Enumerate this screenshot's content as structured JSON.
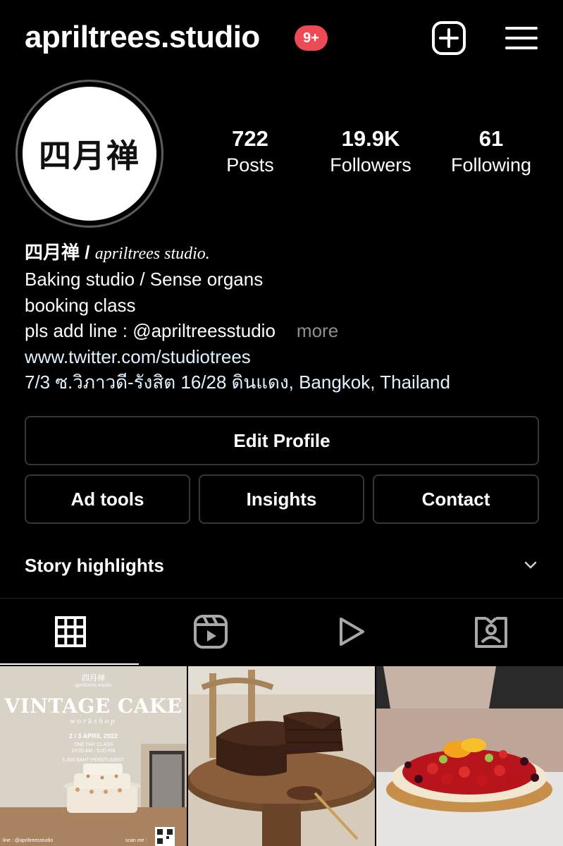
{
  "header": {
    "username": "apriltrees.studio",
    "notification_badge": "9+"
  },
  "profile": {
    "avatar_text": "四月禅",
    "stats": [
      {
        "value": "722",
        "label": "Posts"
      },
      {
        "value": "19.9K",
        "label": "Followers"
      },
      {
        "value": "61",
        "label": "Following"
      }
    ]
  },
  "bio": {
    "name": "四月禅 /",
    "name_sub": "apriltrees studio.",
    "line1": "Baking studio / Sense organs",
    "line2": "booking class",
    "line3": "pls add line : @apriltreesstudio",
    "more": "more",
    "link": "www.twitter.com/studiotrees",
    "location": "7/3 ซ.วิภาวดี-รังสิต 16/28 ดินแดง, Bangkok, Thailand"
  },
  "buttons": {
    "edit_profile": "Edit Profile",
    "ad_tools": "Ad tools",
    "insights": "Insights",
    "contact": "Contact"
  },
  "highlights": {
    "label": "Story highlights"
  },
  "tabs": [
    {
      "icon": "grid-icon",
      "active": true
    },
    {
      "icon": "reels-icon",
      "active": false
    },
    {
      "icon": "video-play-icon",
      "active": false
    },
    {
      "icon": "tagged-icon",
      "active": false
    }
  ],
  "posts": [
    {
      "brand": "四月禅",
      "brand_sub": "apriltrees studio",
      "title": "VINTAGE CAKE",
      "subtitle": "workshop",
      "date": "2 / 3 APRIL 2022",
      "class_type": "ONE DAY CLASS",
      "time": "10:00 AM - 5:00 PM",
      "price": "5,900 BAHT PERSTUDENT",
      "footer_left": "line : @apriltreesstudio",
      "footer_right": "scan me :"
    },
    {
      "description_icon": "chocolate-cake-image"
    },
    {
      "description_icon": "fruit-tart-image"
    }
  ],
  "colors": {
    "background": "#000000",
    "badge": "#ed4956",
    "button_border": "#363636",
    "muted_text": "#8e8e8e",
    "link_text": "#e0f1ff"
  }
}
